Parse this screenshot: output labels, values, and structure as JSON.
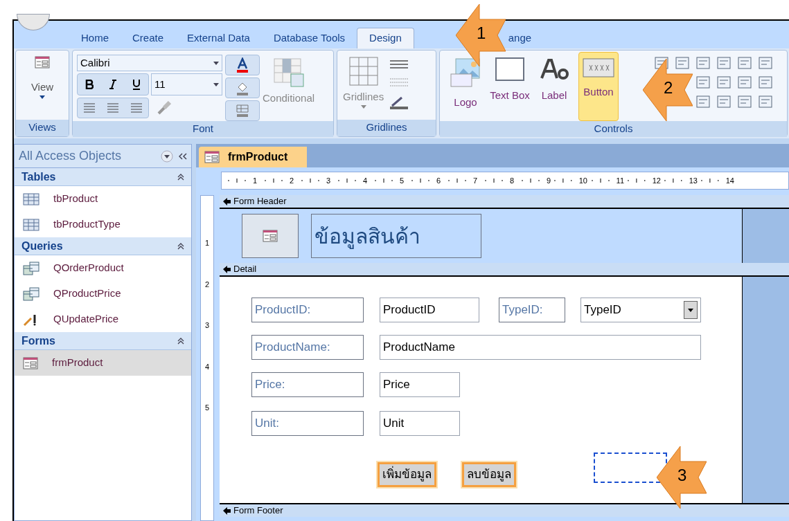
{
  "tabs": [
    {
      "label": "Home",
      "selected": false
    },
    {
      "label": "Create",
      "selected": false
    },
    {
      "label": "External Data",
      "selected": false
    },
    {
      "label": "Database Tools",
      "selected": false
    },
    {
      "label": "Design",
      "selected": true
    },
    {
      "label": "ange",
      "selected": false
    }
  ],
  "ribbon": {
    "views": {
      "label": "View",
      "group": "Views"
    },
    "font": {
      "font_name": "Calibri",
      "font_size": "11",
      "conditional": "Conditional",
      "group": "Font"
    },
    "gridlines": {
      "label": "Gridlines",
      "group": "Gridlines"
    },
    "controls": {
      "items": [
        {
          "label": "Logo",
          "kind": "logo",
          "selected": false
        },
        {
          "label": "Text Box",
          "kind": "textbox",
          "selected": false
        },
        {
          "label": "Label",
          "kind": "label",
          "selected": false
        },
        {
          "label": "Button",
          "kind": "button",
          "selected": true
        }
      ],
      "group": "Controls"
    }
  },
  "navigation": {
    "title": "All Access Objects",
    "groups": [
      {
        "label": "Tables",
        "items": [
          {
            "name": "tbProduct",
            "kind": "table",
            "selected": false
          },
          {
            "name": "tbProductType",
            "kind": "table",
            "selected": false
          }
        ]
      },
      {
        "label": "Queries",
        "items": [
          {
            "name": "QOrderProduct",
            "kind": "query",
            "selected": false
          },
          {
            "name": "QProductPrice",
            "kind": "query",
            "selected": false
          },
          {
            "name": "QUpdatePrice",
            "kind": "update",
            "selected": false
          }
        ]
      },
      {
        "label": "Forms",
        "items": [
          {
            "name": "frmProduct",
            "kind": "form",
            "selected": true
          }
        ]
      }
    ]
  },
  "document_tab": "frmProduct",
  "ruler": [
    "1",
    "2",
    "3",
    "4",
    "5",
    "6",
    "7",
    "8",
    "9",
    "10",
    "11",
    "12",
    "13",
    "14"
  ],
  "vertical_ruler": [
    "1",
    "2",
    "3",
    "4",
    "5"
  ],
  "form": {
    "header_section": "Form Header",
    "title": "ข้อมูลสินค้า",
    "detail_section": "Detail",
    "footer_section": "Form Footer",
    "fields": [
      {
        "label": "ProductID:",
        "value": "ProductID",
        "kind": "text"
      },
      {
        "label": "TypeID:",
        "value": "TypeID",
        "kind": "combo"
      },
      {
        "label": "ProductName:",
        "value": "ProductName",
        "kind": "text"
      },
      {
        "label": "Price:",
        "value": "Price",
        "kind": "text"
      },
      {
        "label": "Unit:",
        "value": "Unit",
        "kind": "text"
      }
    ],
    "buttons": [
      {
        "label": "เพิ่มข้อมูล",
        "selected": true
      },
      {
        "label": "ลบข้อมูล",
        "selected": true
      }
    ]
  },
  "callouts": [
    "1",
    "2",
    "3"
  ]
}
